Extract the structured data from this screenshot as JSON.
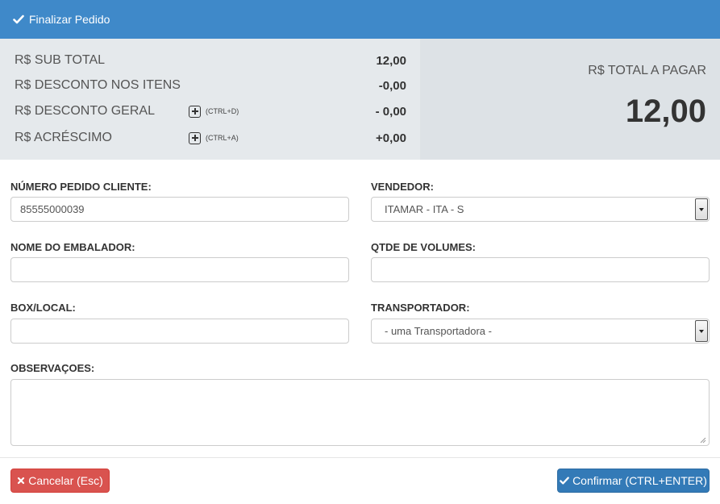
{
  "header": {
    "title": "Finalizar Pedido",
    "icon": "check-icon"
  },
  "summary": {
    "rows": [
      {
        "label": "R$ SUB TOTAL",
        "value": "12,00"
      },
      {
        "label": "R$ DESCONTO NOS ITENS",
        "value": "-0,00"
      },
      {
        "label": "R$ DESCONTO GERAL",
        "value": "- 0,00",
        "shortcut": "(CTRL+D)"
      },
      {
        "label": "R$ ACRÉSCIMO",
        "value": "+0,00",
        "shortcut": "(CTRL+A)"
      }
    ]
  },
  "total": {
    "label": "R$ TOTAL A PAGAR",
    "value": "12,00"
  },
  "form": {
    "numero_pedido": {
      "label": "NÚMERO PEDIDO CLIENTE:",
      "value": "85555000039"
    },
    "vendedor": {
      "label": "VENDEDOR:",
      "value": "ITAMAR - ITA - S"
    },
    "embalador": {
      "label": "NOME DO EMBALADOR:",
      "value": ""
    },
    "volumes": {
      "label": "QTDE DE VOLUMES:",
      "value": ""
    },
    "box": {
      "label": "BOX/LOCAL:",
      "value": ""
    },
    "transportador": {
      "label": "TRANSPORTADOR:",
      "value": "- uma Transportadora -"
    },
    "observacoes": {
      "label": "OBSERVAÇOES:",
      "value": ""
    }
  },
  "buttons": {
    "cancel": "Cancelar (Esc)",
    "confirm": "Confirmar (CTRL+ENTER)"
  },
  "colors": {
    "header_bg": "#3f89c9",
    "cancel_bg": "#d9534f",
    "confirm_bg": "#337ab7"
  }
}
